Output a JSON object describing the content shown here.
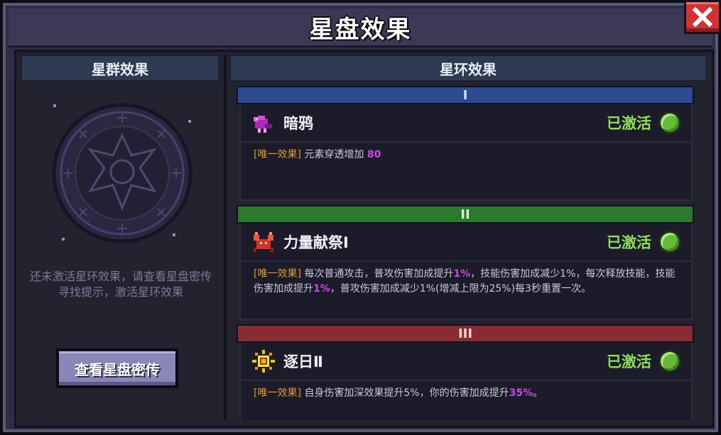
{
  "window": {
    "title": "星盘效果",
    "close_icon": "close-icon"
  },
  "left": {
    "header": "星群效果",
    "emblem_icon": "star-constellation-emblem-icon",
    "hint": "还未激活星环效果，请查看星盘密传寻找提示，激活星环效果",
    "button": "查看星盘密传"
  },
  "right": {
    "header": "星环效果",
    "tiers": [
      {
        "numeral": "I",
        "color": "#2d4b8e",
        "effect": {
          "icon": "raven-icon",
          "name": "暗鸦",
          "status": "已激活",
          "tag": "[唯一效果]",
          "desc_parts": [
            "元素穿透增加 ",
            "80"
          ]
        }
      },
      {
        "numeral": "II",
        "color": "#2b7a2b",
        "effect": {
          "icon": "crab-icon",
          "name": "力量献祭Ⅰ",
          "status": "已激活",
          "tag": "[唯一效果]",
          "desc_parts": [
            "每次普通攻击，普攻伤害加成提升",
            "1%",
            "，技能伤害加成减少1%，每次释放技能，技能伤害加成提升",
            "1%",
            "，普攻伤害加成减少1%(增减上限为25%)每3秒重置一次。"
          ]
        }
      },
      {
        "numeral": "III",
        "color": "#8a2a32",
        "effect": {
          "icon": "sun-icon",
          "name": "逐日Ⅱ",
          "status": "已激活",
          "tag": "[唯一效果]",
          "desc_parts": [
            "自身伤害加深效果提升5%，你的伤害加成提升",
            "35%",
            "。"
          ]
        }
      }
    ]
  },
  "colors": {
    "active_green": "#8ee05a",
    "tag_orange": "#e09a2c",
    "highlight_purple": "#c948e0"
  }
}
